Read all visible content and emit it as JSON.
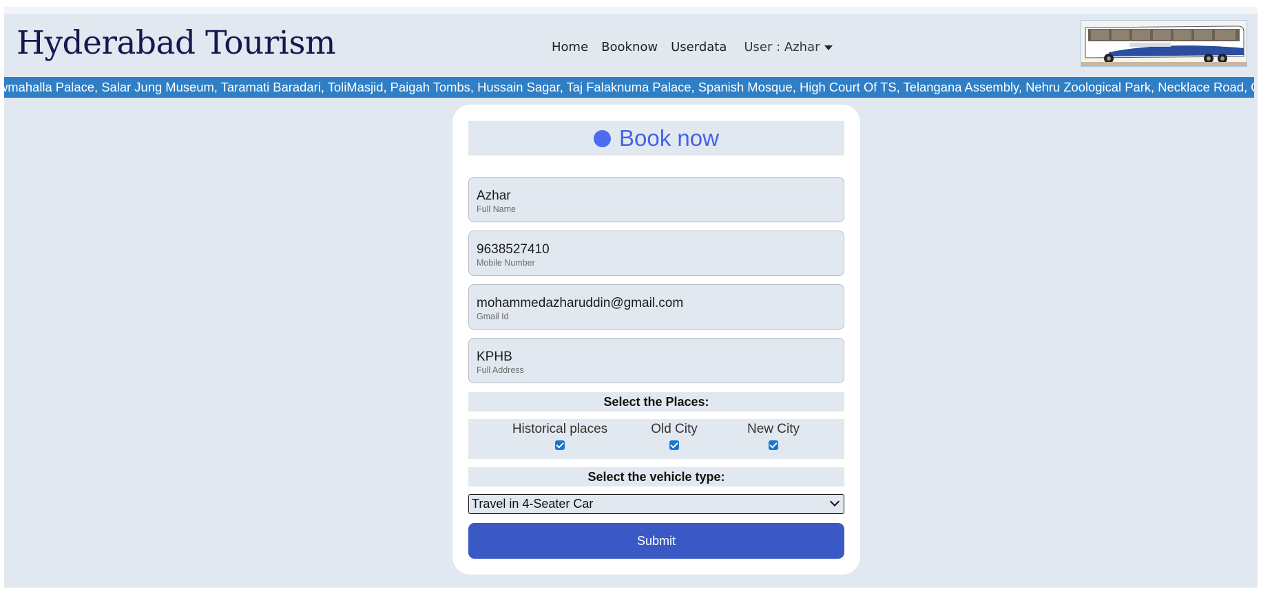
{
  "brand": "Hyderabad Tourism",
  "nav": {
    "links": [
      "Home",
      "Booknow",
      "Userdata"
    ],
    "user_label": "User : Azhar"
  },
  "marquee_text": "wmahalla Palace, Salar Jung Museum, Taramati Baradari, ToliMasjid, Paigah Tombs, Hussain Sagar, Taj Falaknuma Palace, Spanish Mosque, High Court Of TS, Telangana Assembly, Nehru Zoological Park, Necklace Road, C",
  "form": {
    "title": "Book now",
    "fields": [
      {
        "value": "Azhar",
        "label": "Full Name"
      },
      {
        "value": "9638527410",
        "label": "Mobile Number"
      },
      {
        "value": "mohammedazharuddin@gmail.com",
        "label": "Gmail Id"
      },
      {
        "value": "KPHB",
        "label": "Full Address"
      }
    ],
    "places_heading": "Select the Places:",
    "places": [
      {
        "label": "Historical places",
        "checked": true
      },
      {
        "label": "Old City",
        "checked": true
      },
      {
        "label": "New City",
        "checked": true
      }
    ],
    "vehicle_heading": "Select the vehicle type:",
    "vehicle_selected": "Travel in 4-Seater Car",
    "submit_label": "Submit"
  },
  "colors": {
    "page_bg": "#e2e8ef",
    "brand_text": "#1a1550",
    "marquee_bg": "#2f7fc6",
    "title_accent": "#4463e6",
    "submit_bg": "#3a59c5",
    "checkbox": "#1976d2"
  }
}
